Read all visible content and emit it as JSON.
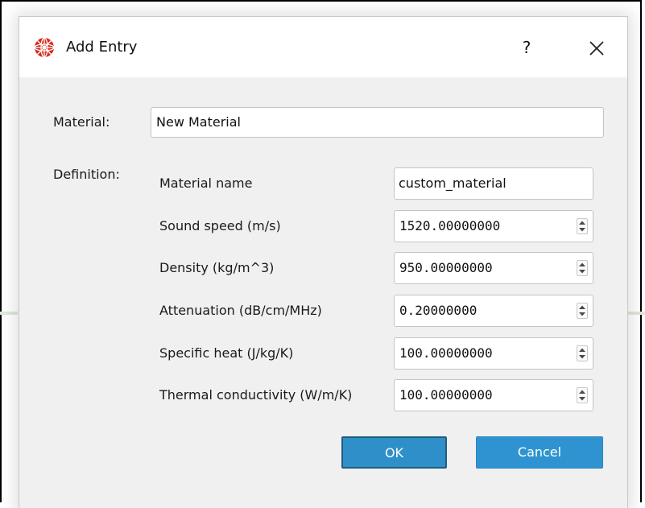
{
  "dialog": {
    "title": "Add Entry",
    "help_label": "?",
    "icons": {
      "app": "app-logo-icon",
      "close": "close-icon",
      "spin": "spin-arrows-icon"
    }
  },
  "form": {
    "material_label": "Material:",
    "material_value": "New Material",
    "definition_label": "Definition:",
    "fields": [
      {
        "label": "Material name",
        "value": "custom_material"
      },
      {
        "label": "Sound speed (m/s)",
        "value": "1520.00000000"
      },
      {
        "label": "Density (kg/m^3)",
        "value": "950.00000000"
      },
      {
        "label": "Attenuation (dB/cm/MHz)",
        "value": "0.20000000"
      },
      {
        "label": "Specific heat (J/kg/K)",
        "value": "100.00000000"
      },
      {
        "label": "Thermal conductivity (W/m/K)",
        "value": "100.00000000"
      }
    ]
  },
  "buttons": {
    "ok": "OK",
    "cancel": "Cancel"
  },
  "colors": {
    "button_primary": "#2f93d1",
    "dialog_bg": "#f0f0f0",
    "title_bg": "#ffffff",
    "logo_red": "#d9281c"
  }
}
